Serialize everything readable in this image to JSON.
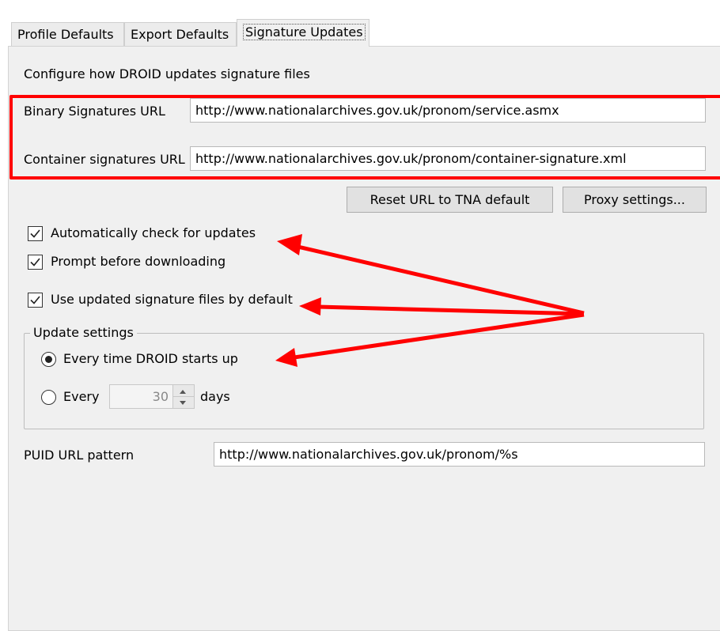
{
  "tabs": [
    {
      "label": "Profile Defaults"
    },
    {
      "label": "Export Defaults"
    },
    {
      "label": "Signature Updates"
    }
  ],
  "panel": {
    "description": "Configure how DROID updates signature files",
    "binary": {
      "label": "Binary Signatures URL",
      "value": "http://www.nationalarchives.gov.uk/pronom/service.asmx"
    },
    "container": {
      "label": "Container signatures URL",
      "value": "http://www.nationalarchives.gov.uk/pronom/container-signature.xml"
    },
    "buttons": {
      "reset": "Reset URL to TNA default",
      "proxy": "Proxy settings..."
    },
    "checkboxes": [
      {
        "label": "Automatically check for updates",
        "checked": true
      },
      {
        "label": "Prompt before downloading",
        "checked": true
      },
      {
        "label": "Use updated signature files by default",
        "checked": true
      }
    ],
    "update_settings": {
      "title": "Update settings",
      "option_startup": "Every time DROID starts up",
      "option_every": "Every",
      "selected": "startup",
      "days_value": "30",
      "days_label": "days"
    },
    "puid": {
      "label": "PUID URL pattern",
      "value": "http://www.nationalarchives.gov.uk/pronom/%s"
    }
  },
  "annotation_color": "#ff0000"
}
